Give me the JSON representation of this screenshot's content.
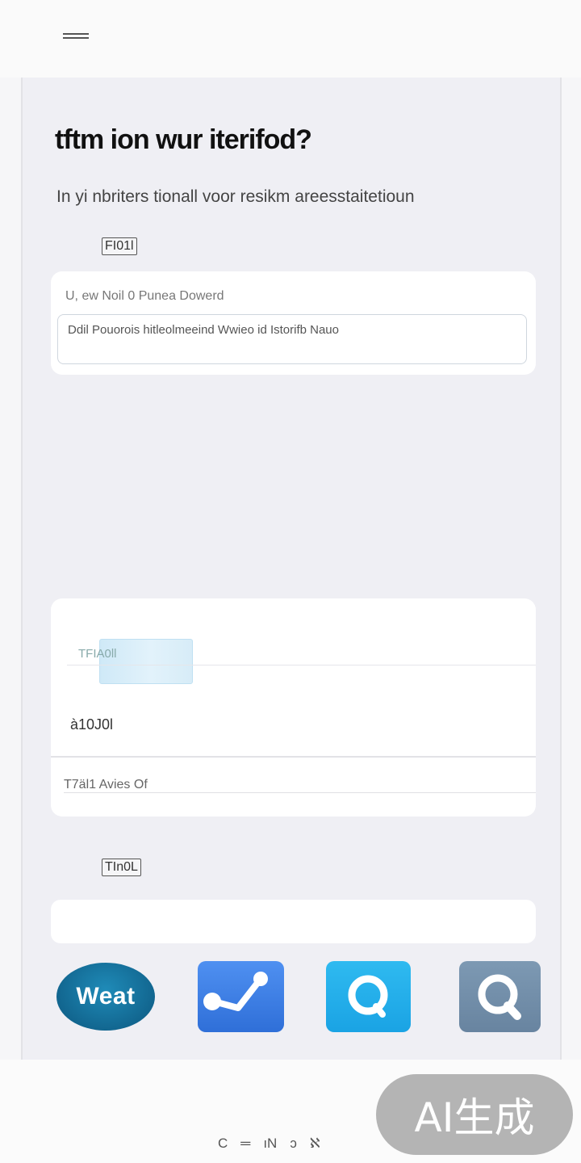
{
  "header": {
    "menu_icon": "hamburger-icon"
  },
  "form": {
    "title": "tftm ion wur iterifod?",
    "subtitle": "In yi nbriters tionall voor resikm areesstaitetioun",
    "section1_tag": "FI01l",
    "field": {
      "label": "U, ew Noil 0 Punea Dowerd",
      "placeholder": "Ddil Pouorois hitleolmeeind Wwieo id Istorifb Nauo"
    },
    "card2": {
      "thumb_label": "TFIA0ll",
      "value": "à10J0l",
      "footer": "T7äl1 Avies Of"
    },
    "section2_tag": "TIn0L"
  },
  "apps": [
    {
      "name": "weat-app",
      "label": "Weat"
    },
    {
      "name": "graph-app",
      "icon": "chart-icon"
    },
    {
      "name": "search-app-blue",
      "icon": "search-icon"
    },
    {
      "name": "search-app-grey",
      "icon": "search-icon"
    }
  ],
  "bottom_nav": {
    "glyphs": [
      "C",
      "═",
      "ıΝ",
      "ɔ",
      "ℵ"
    ]
  },
  "badge": {
    "text": "AI生成"
  }
}
